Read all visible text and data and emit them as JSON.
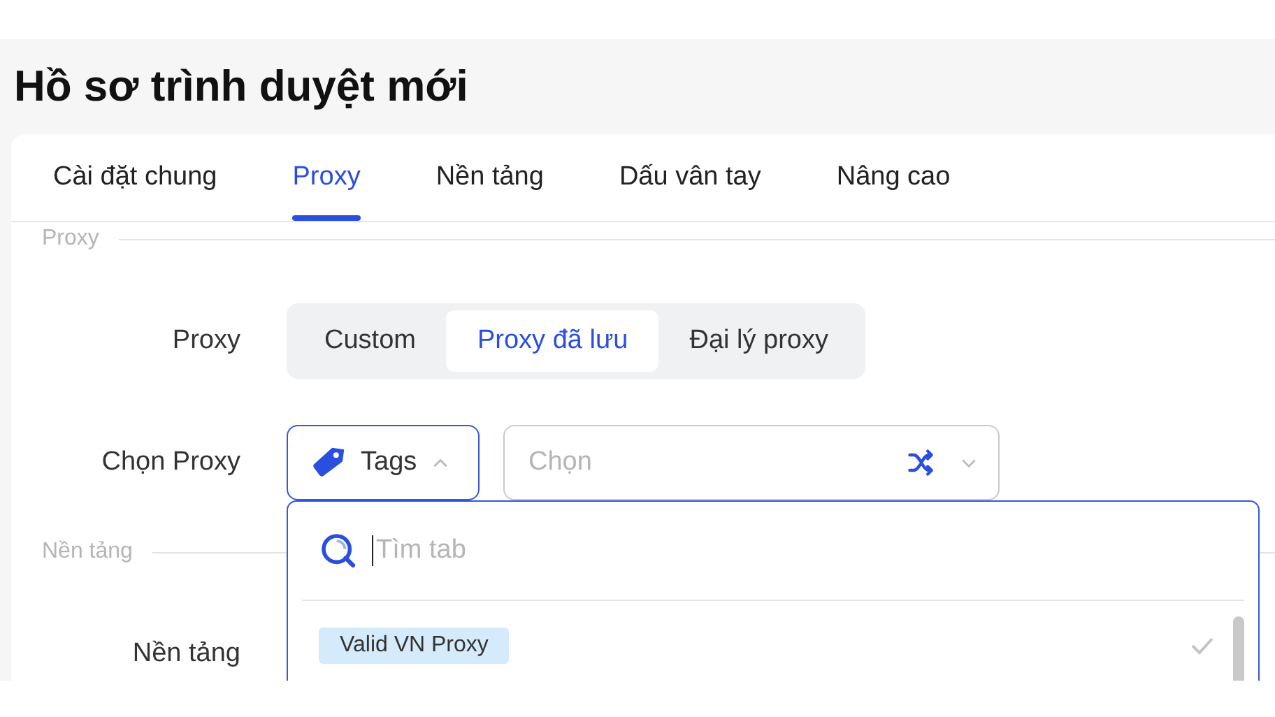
{
  "window": {
    "title": "Hồ sơ trình duyệt mới"
  },
  "tabs": [
    {
      "label": "Cài đặt chung",
      "selected": false
    },
    {
      "label": "Proxy",
      "selected": true
    },
    {
      "label": "Nền tảng",
      "selected": false
    },
    {
      "label": "Dấu vân tay",
      "selected": false
    },
    {
      "label": "Nâng cao",
      "selected": false
    }
  ],
  "sections": [
    {
      "title": "Proxy",
      "rows": [
        {
          "kind": "segmented",
          "label": "Proxy",
          "options": [
            {
              "label": "Custom",
              "selected": false
            },
            {
              "label": "Proxy đã lưu",
              "selected": true
            },
            {
              "label": "Đại lý proxy",
              "selected": false
            }
          ]
        },
        {
          "kind": "picker",
          "label": "Chọn Proxy",
          "filter": {
            "label": "Tags",
            "expanded": true,
            "menu": {
              "search": {
                "placeholder": "Tìm tab"
              },
              "options": [
                {
                  "label": "Valid VN Proxy",
                  "selected": false
                }
              ]
            }
          },
          "field": {
            "placeholder": "Chọn"
          }
        }
      ]
    },
    {
      "title": "Nền tảng",
      "rows": [
        {
          "kind": "text",
          "label": "Nền tảng"
        }
      ]
    }
  ]
}
